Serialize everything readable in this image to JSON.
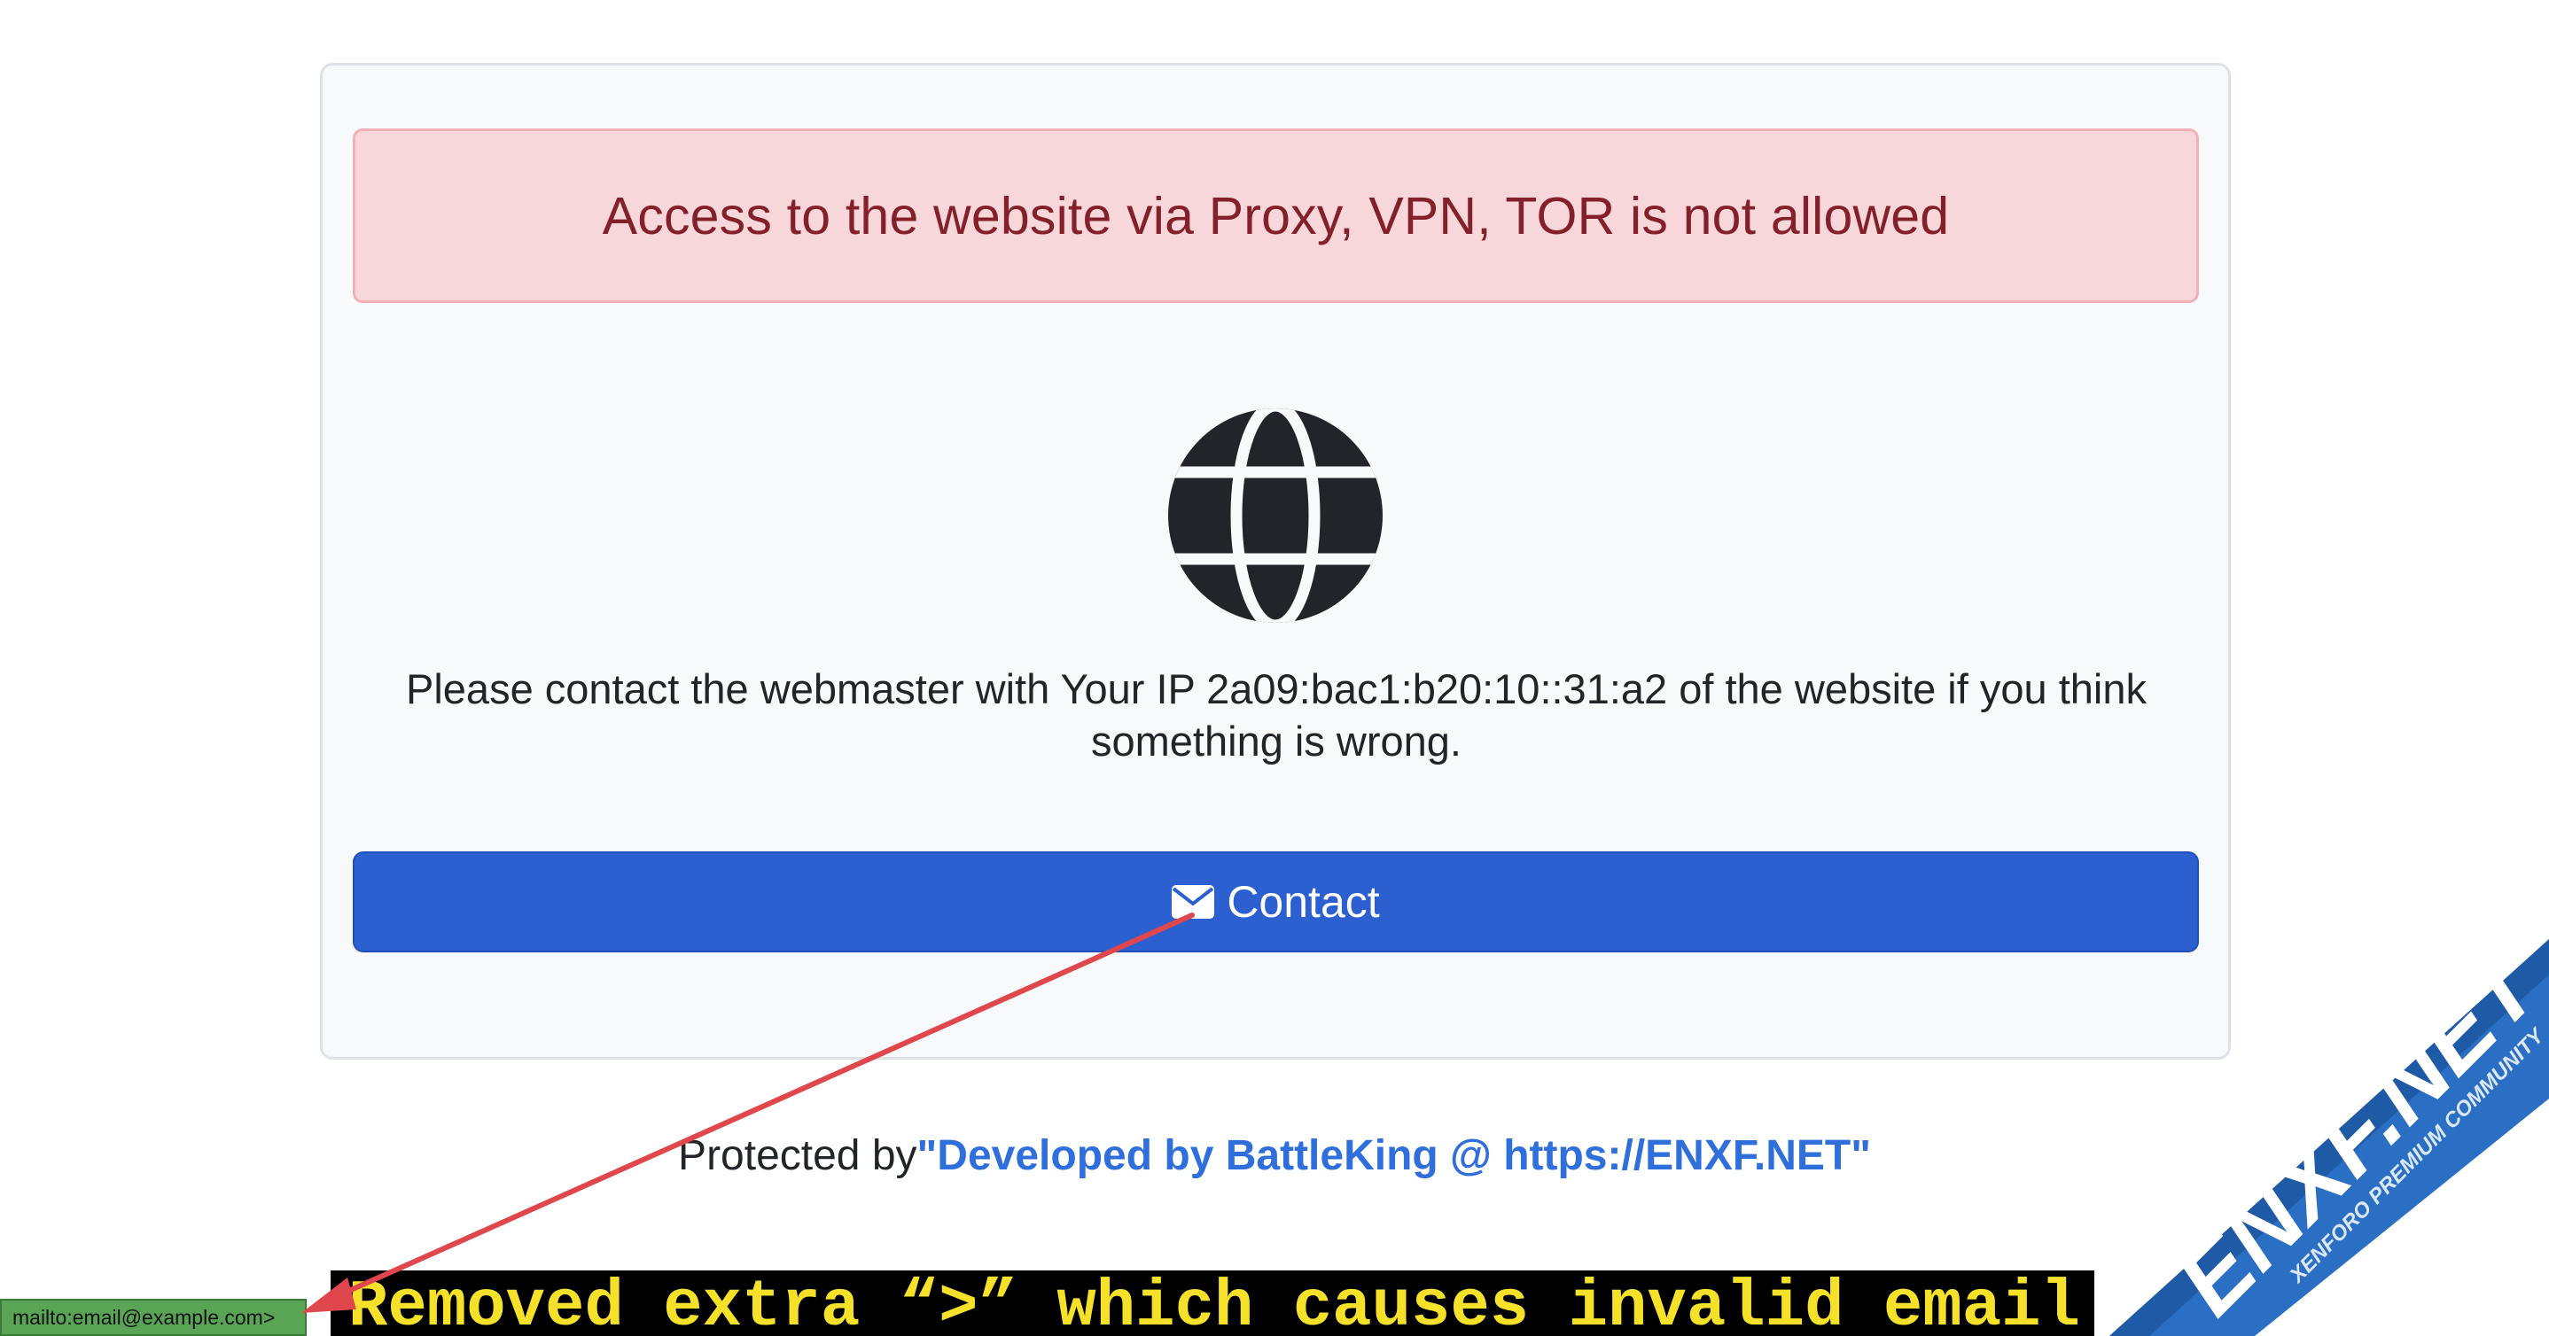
{
  "alert": {
    "text": "Access to the website via Proxy, VPN, TOR is not allowed"
  },
  "icons": {
    "main": "globe-icon",
    "button": "envelope-icon"
  },
  "message": {
    "text": "Please contact the webmaster with Your IP 2a09:bac1:b20:10::31:a2 of the website if you think something is wrong."
  },
  "contact_button": {
    "label": "Contact"
  },
  "footer": {
    "protected_prefix": "Protected by",
    "protected_link": "\"Developed by BattleKing @ https://ENXF.NET\""
  },
  "status_bar": {
    "url": "mailto:email@example.com>"
  },
  "annotation": {
    "text": "Removed extra “>” which causes invalid email"
  },
  "watermark": {
    "title": "ENXF.NET",
    "subtitle": "XENFORO PREMIUM COMMUNITY"
  },
  "colors": {
    "alert_bg": "#f8d7da",
    "alert_text": "#842029",
    "button_bg": "#2c5fcf",
    "link": "#2f6fdb",
    "annotation_text": "#f5e12a",
    "arrow": "#e0474c",
    "ribbon": "#2a6fc4"
  }
}
